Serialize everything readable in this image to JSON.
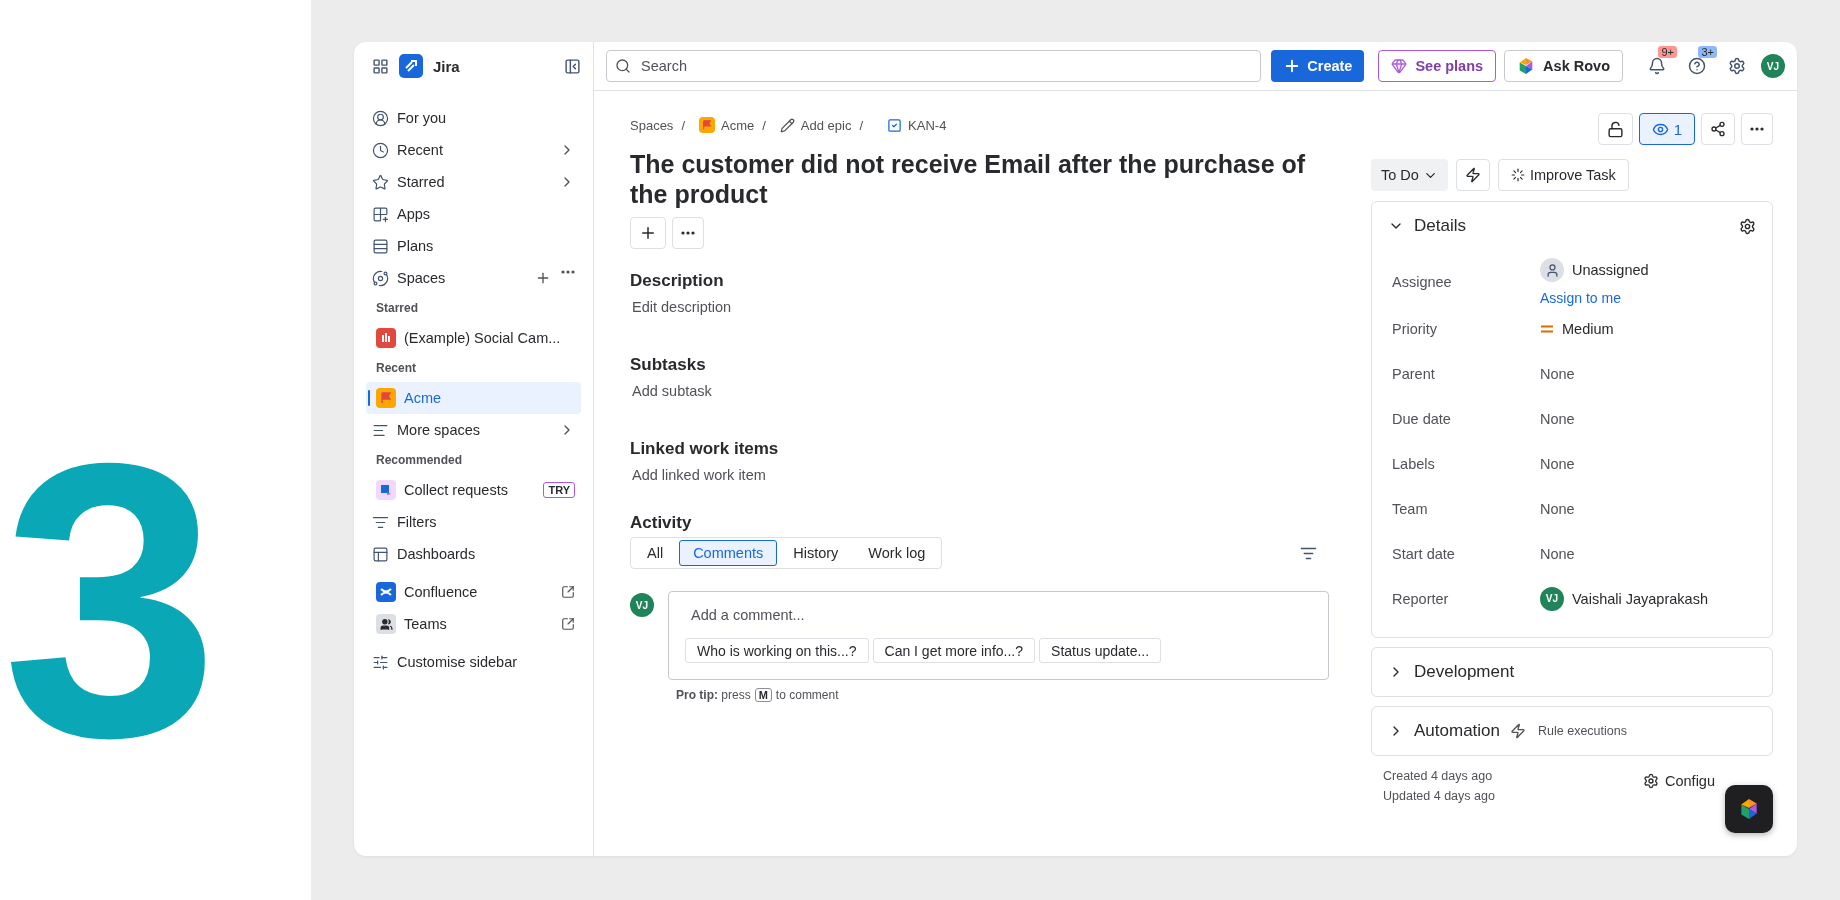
{
  "hero_number": "3",
  "sidebar": {
    "app_name": "Jira",
    "items": [
      {
        "kind": "nav",
        "label": "For you",
        "selected": false
      },
      {
        "kind": "nav",
        "label": "Recent",
        "chevron": true,
        "selected": false
      },
      {
        "kind": "nav",
        "label": "Starred",
        "chevron": true,
        "selected": false
      },
      {
        "kind": "nav",
        "label": "Apps",
        "selected": false
      },
      {
        "kind": "nav",
        "label": "Plans",
        "selected": false
      },
      {
        "kind": "nav",
        "label": "Spaces",
        "actions": true,
        "selected": false
      },
      {
        "kind": "heading",
        "label": "Starred"
      },
      {
        "kind": "space",
        "label": "(Example) Social Cam...",
        "selected": false
      },
      {
        "kind": "heading",
        "label": "Recent"
      },
      {
        "kind": "space",
        "label": "Acme",
        "selected": true
      },
      {
        "kind": "space",
        "label": "More spaces",
        "chevron": true,
        "selected": false
      },
      {
        "kind": "heading",
        "label": "Recommended"
      },
      {
        "kind": "space",
        "label": "Collect requests",
        "badge": "TRY",
        "selected": false
      },
      {
        "kind": "nav",
        "label": "Filters",
        "selected": false
      },
      {
        "kind": "nav",
        "label": "Dashboards",
        "selected": false
      },
      {
        "kind": "nav",
        "label": "Confluence",
        "external": true,
        "selected": false
      },
      {
        "kind": "nav",
        "label": "Teams",
        "external": true,
        "selected": false
      },
      {
        "kind": "nav",
        "label": "Customise sidebar",
        "selected": false
      }
    ]
  },
  "topbar": {
    "search": {
      "placeholder": "Search"
    },
    "create": "Create",
    "see_plans": "See plans",
    "ask_rovo": "Ask Rovo",
    "notifications_badge": "9+",
    "help_badge": "3+",
    "avatar": "VJ"
  },
  "breadcrumb": {
    "separator": "/",
    "items": [
      "Spaces",
      "Acme",
      "Add epic",
      "KAN-4"
    ]
  },
  "issue": {
    "title": "The customer did not receive Email after the purchase of the product",
    "sections": [
      {
        "heading": "Description",
        "placeholder": "Edit description"
      },
      {
        "heading": "Subtasks",
        "placeholder": "Add subtask"
      },
      {
        "heading": "Linked work items",
        "placeholder": "Add linked work item"
      }
    ],
    "activity": {
      "heading": "Activity",
      "tabs": [
        {
          "label": "All",
          "selected": false
        },
        {
          "label": "Comments",
          "selected": true
        },
        {
          "label": "History",
          "selected": false
        },
        {
          "label": "Work log",
          "selected": false
        }
      ],
      "avatar": "VJ",
      "comment": {
        "placeholder": "Add a comment..."
      },
      "suggestions": [
        "Who is working on this...?",
        "Can I get more info...?",
        "Status update..."
      ],
      "pro_tip": {
        "lead": "**Pro tip:** press",
        "key": "M",
        "tail": "to comment"
      }
    }
  },
  "side": {
    "watchers": "1",
    "watching": true,
    "status": "To Do",
    "improve": "Improve Task",
    "details": {
      "title": "Details",
      "expanded": true,
      "fields": [
        {
          "kind": "assignee",
          "label": "Assignee",
          "value": "Unassigned",
          "action": "Assign to me"
        },
        {
          "kind": "priority",
          "label": "Priority",
          "value": "Medium"
        },
        {
          "kind": "empty",
          "label": "Parent",
          "value": "None"
        },
        {
          "kind": "empty",
          "label": "Due date",
          "value": "None"
        },
        {
          "kind": "empty",
          "label": "Labels",
          "value": "None"
        },
        {
          "kind": "empty",
          "label": "Team",
          "value": "None"
        },
        {
          "kind": "empty",
          "label": "Start date",
          "value": "None"
        },
        {
          "kind": "user",
          "label": "Reporter",
          "value": "Vaishali Jayaprakash",
          "avatar": "VJ"
        }
      ]
    },
    "panels": [
      {
        "title": "Development",
        "expanded": false
      },
      {
        "title": "Automation",
        "expanded": false,
        "note": "Rule executions"
      }
    ],
    "created": "Created 4 days ago",
    "updated": "Updated 4 days ago",
    "configure": "Configu"
  }
}
